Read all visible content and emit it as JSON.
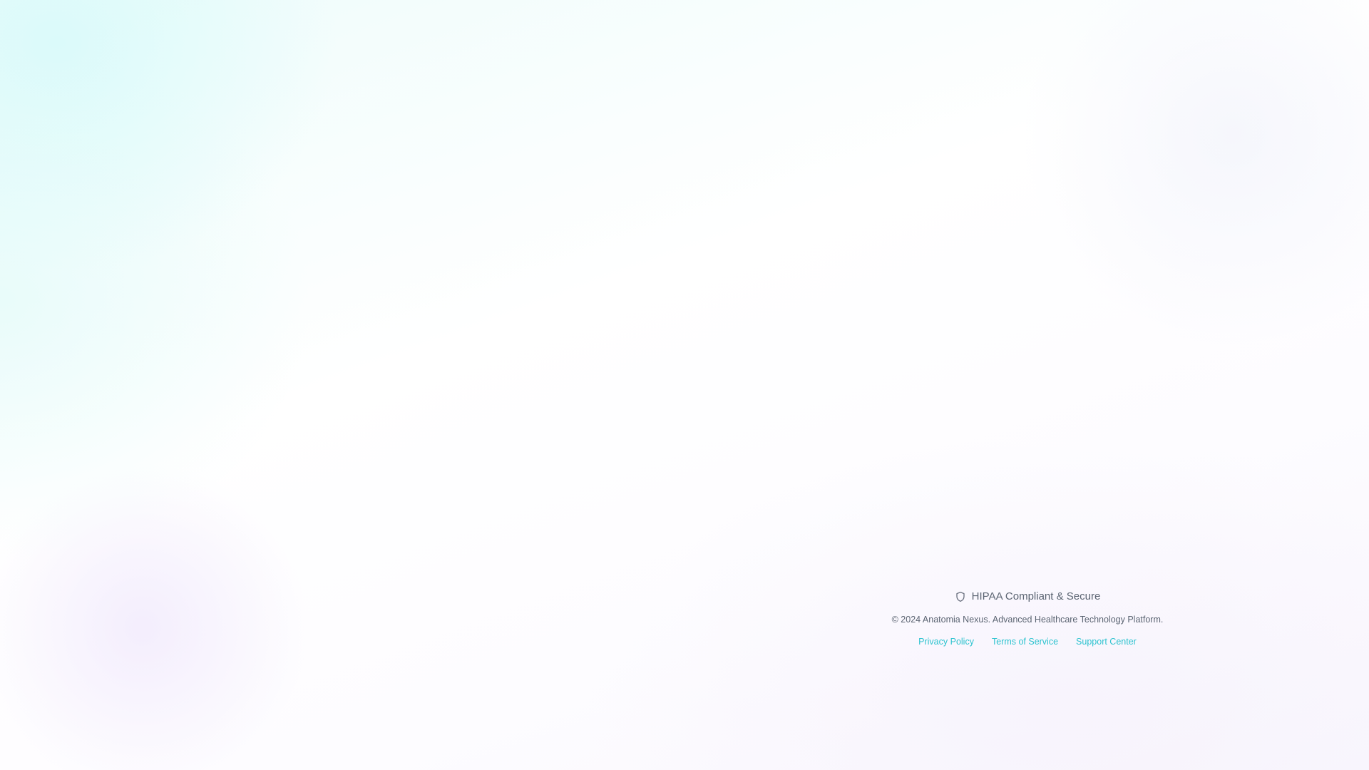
{
  "footer": {
    "compliance": {
      "icon": "shield-icon",
      "label": "HIPAA Compliant & Secure"
    },
    "copyright": "© 2024 Anatomia Nexus. Advanced Healthcare Technology Platform.",
    "links": [
      {
        "label": "Privacy Policy"
      },
      {
        "label": "Terms of Service"
      },
      {
        "label": "Support Center"
      }
    ]
  },
  "colors": {
    "link": "#2cc3cf",
    "muted_text": "#5b6472"
  }
}
